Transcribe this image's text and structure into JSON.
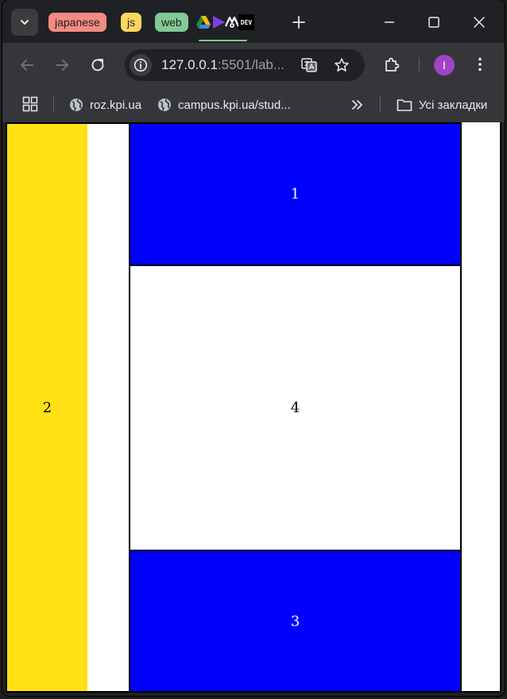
{
  "tab_groups": [
    {
      "label": "japanese",
      "color": "#f28b82"
    },
    {
      "label": "js",
      "color": "#fdd663"
    },
    {
      "label": "web",
      "color": "#81c995"
    }
  ],
  "favicons": [
    "drive-icon",
    "play-icon",
    "ai-icon",
    "dev-icon"
  ],
  "dev_favicon_text": "DEV",
  "omnibox": {
    "host": "127.0.0.1",
    "path": ":5501/lab..."
  },
  "profile_initial": "I",
  "bookmarks": [
    {
      "label": "roz.kpi.ua",
      "icon": "globe-icon"
    },
    {
      "label": "campus.kpi.ua/stud...",
      "icon": "globe-icon"
    }
  ],
  "all_bookmarks_label": "Усі закладки",
  "page": {
    "cells": {
      "one": "1",
      "two": "2",
      "three": "3",
      "four": "4"
    },
    "colors": {
      "yellow": "#ffe114",
      "blue": "#0000ff",
      "white": "#ffffff"
    }
  },
  "theme": {
    "tabstrip": "#202124",
    "toolbar": "#35363a",
    "avatar": "#a142c7"
  }
}
